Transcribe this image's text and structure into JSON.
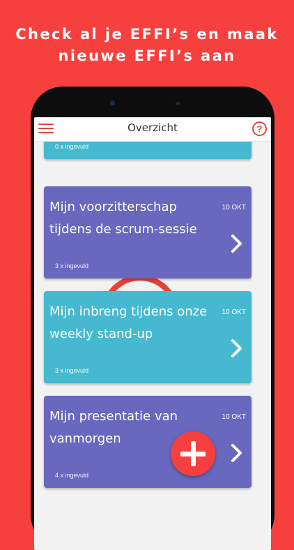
{
  "promo": {
    "line1": "Check al je EFFI’s en maak",
    "line2": "nieuwe EFFI’s aan"
  },
  "appbar": {
    "title": "Overzicht",
    "menu_icon": "hamburger-menu-icon",
    "help_icon": "question-circle-icon",
    "help_glyph": "?"
  },
  "cards": [
    {
      "title": "",
      "date": "",
      "count": "0 x ingevuld",
      "color": "#46B9D1"
    },
    {
      "title": "Mijn voorzitterschap tijdens de scrum-sessie",
      "date": "10 OKT",
      "count": "3 x ingevuld",
      "color": "#6868BF"
    },
    {
      "title": "Mijn inbreng tijdens onze weekly stand-up",
      "date": "10 OKT",
      "count": "3 x ingevuld",
      "color": "#46B9D1"
    },
    {
      "title": "Mijn presentatie van vanmorgen",
      "date": "10 OKT",
      "count": "4 x ingevuld",
      "color": "#6868BF"
    }
  ],
  "fab": {
    "icon": "plus-icon",
    "color": "#F6403E"
  },
  "colors": {
    "background": "#F6403E",
    "accent": "#E8463F"
  }
}
